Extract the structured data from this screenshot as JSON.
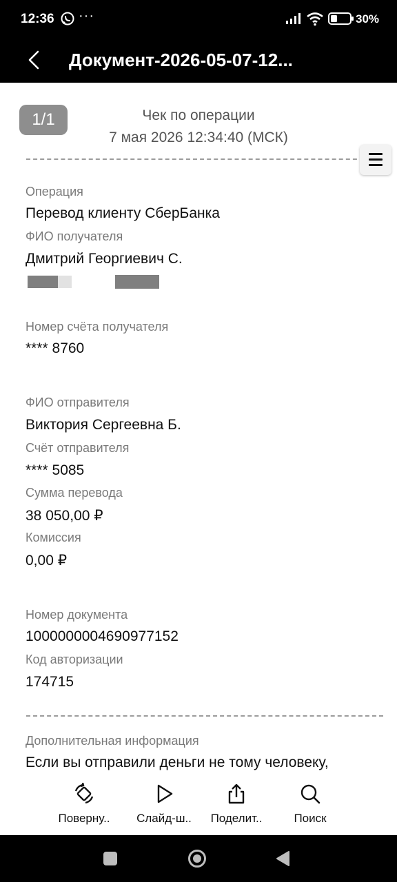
{
  "status_bar": {
    "time": "12:36",
    "dots": "···",
    "battery": "30%",
    "icons": [
      "whatsapp-icon",
      "more-dots-icon",
      "signal-icon",
      "wifi-icon",
      "battery-icon"
    ]
  },
  "header": {
    "title": "Документ-2026-05-07-12..."
  },
  "receipt": {
    "page_indicator": "1/1",
    "title": "Чек по операции",
    "date": "7 мая 2026 12:34:40 (МСК)",
    "fields": [
      {
        "label": "Операция",
        "value": "Перевод клиенту СберБанка"
      },
      {
        "label": "ФИО получателя",
        "value": "Дмитрий Георгиевич С."
      },
      {
        "label": "Номер счёта получателя",
        "value": "**** 8760"
      },
      {
        "label": "ФИО отправителя",
        "value": "Виктория Сергеевна Б."
      },
      {
        "label": "Счёт отправителя",
        "value": "**** 5085"
      },
      {
        "label": "Сумма перевода",
        "value": "38 050,00 ₽"
      },
      {
        "label": "Комиссия",
        "value": "0,00 ₽"
      },
      {
        "label": "Номер документа",
        "value": "1000000004690977152"
      },
      {
        "label": "Код авторизации",
        "value": "174715"
      }
    ],
    "additional": {
      "label": "Дополнительная информация",
      "text": "Если вы отправили деньги не тому человеку,"
    }
  },
  "toolbar": {
    "items": [
      {
        "label": "Поверну..",
        "icon": "rotate-icon"
      },
      {
        "label": "Слайд-ш..",
        "icon": "play-icon"
      },
      {
        "label": "Поделит..",
        "icon": "share-icon"
      },
      {
        "label": "Поиск",
        "icon": "search-icon"
      }
    ]
  },
  "nav": {
    "icons": [
      "recents-square-icon",
      "home-circle-icon",
      "back-triangle-icon"
    ]
  },
  "colors": {
    "sber_green": "#21a038",
    "badge_gray": "#8e8e8e"
  }
}
